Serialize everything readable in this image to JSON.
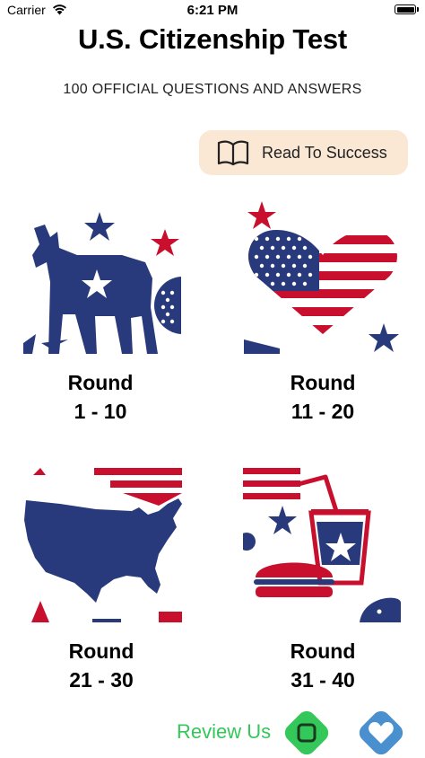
{
  "status_bar": {
    "carrier": "Carrier",
    "time": "6:21 PM"
  },
  "header": {
    "title": "U.S. Citizenship Test",
    "subtitle": "100 OFFICIAL QUESTIONS AND ANSWERS"
  },
  "read_button": {
    "label": "Read To Success",
    "icon": "book-icon"
  },
  "rounds": [
    {
      "title": "Round",
      "range": "1 - 10",
      "image": "donkey-stars-image"
    },
    {
      "title": "Round",
      "range": "11 - 20",
      "image": "flag-heart-image"
    },
    {
      "title": "Round",
      "range": "21 - 30",
      "image": "usa-map-image"
    },
    {
      "title": "Round",
      "range": "31 - 40",
      "image": "burger-soda-image"
    }
  ],
  "footer": {
    "review_label": "Review Us",
    "review_icon": "review-app-icon",
    "favorite_icon": "heart-icon"
  },
  "colors": {
    "navy": "#283a7c",
    "red": "#c8102e",
    "cream": "#fae7d4",
    "green": "#34c759",
    "blue": "#4a8fce"
  }
}
